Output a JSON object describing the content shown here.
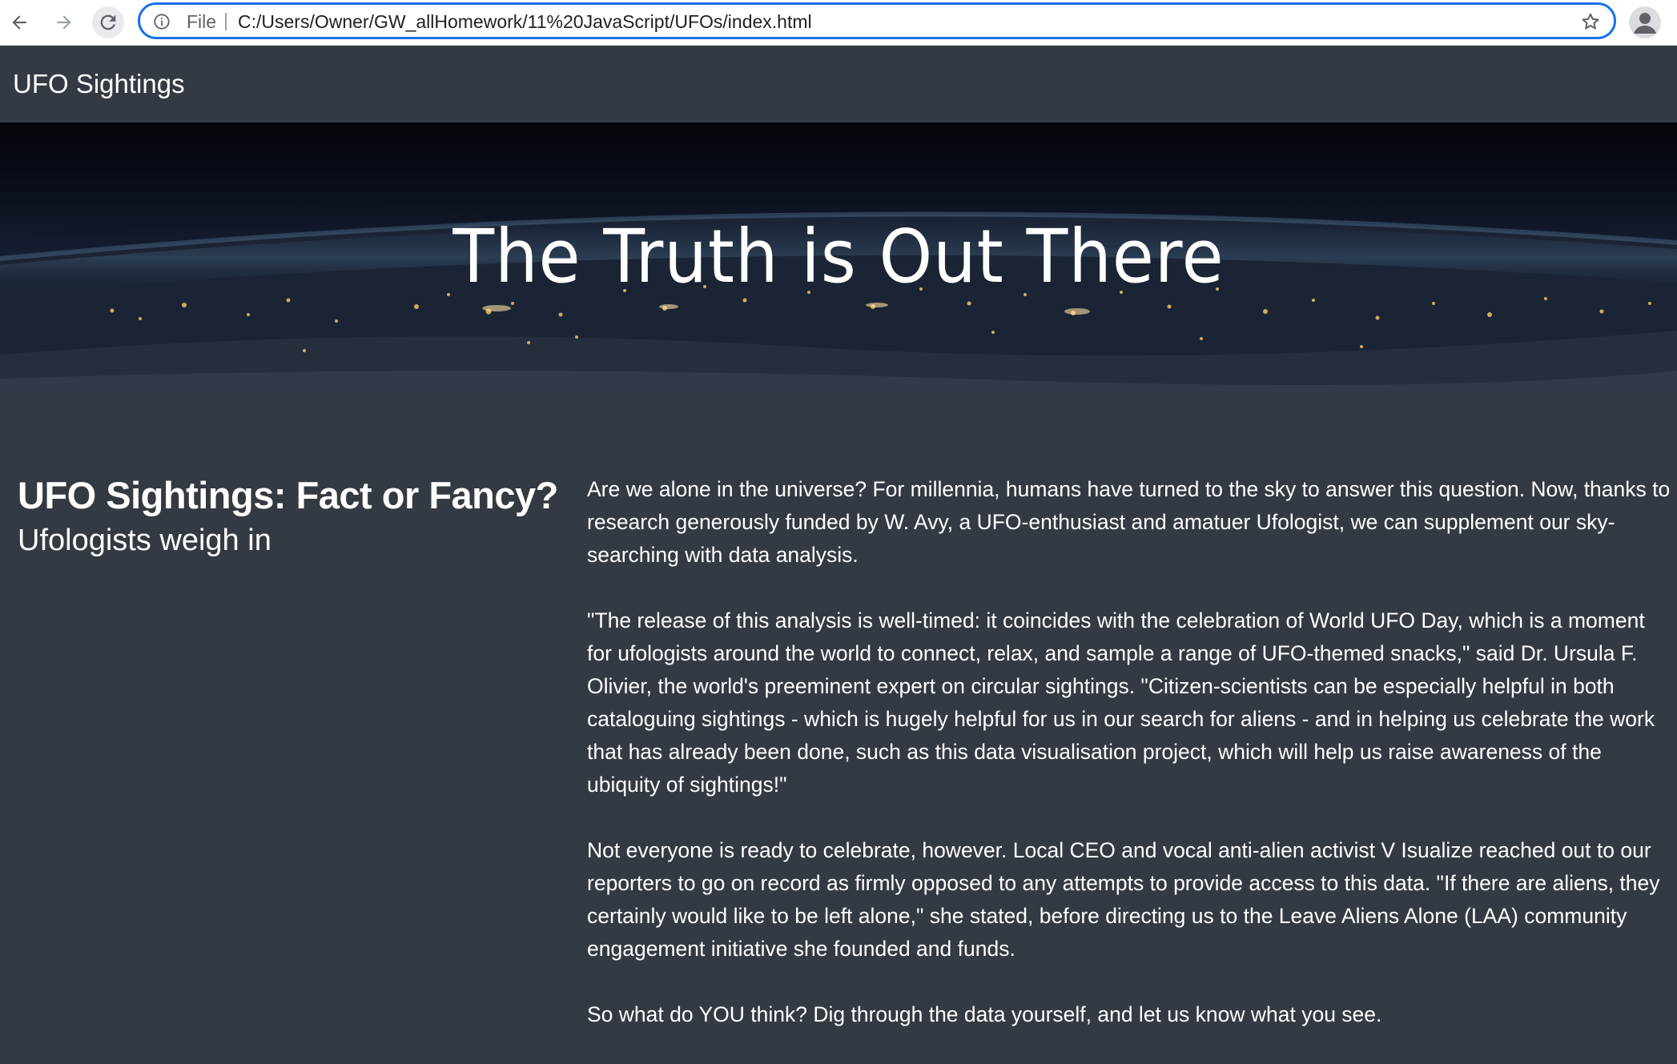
{
  "browser": {
    "file_label": "File",
    "url": "C:/Users/Owner/GW_allHomework/11%20JavaScript/UFOs/index.html",
    "icons": [
      "back-arrow-icon",
      "forward-arrow-icon",
      "reload-icon",
      "info-icon",
      "star-icon",
      "profile-icon"
    ]
  },
  "navbar": {
    "brand": "UFO Sightings"
  },
  "hero": {
    "title": "The Truth is Out There"
  },
  "main": {
    "heading": "UFO Sightings: Fact or Fancy?",
    "subheading": "Ufologists weigh in",
    "paragraphs": [
      "Are we alone in the universe? For millennia, humans have turned to the sky to answer this question. Now, thanks to research generously funded by W. Avy, a UFO-enthusiast and amatuer Ufologist, we can supplement our sky-searching with data analysis.",
      "\"The release of this analysis is well-timed: it coincides with the celebration of World UFO Day, which is a moment for ufologists around the world to connect, relax, and sample a range of UFO-themed snacks,\" said Dr. Ursula F. Olivier, the world's preeminent expert on circular sightings. \"Citizen-scientists can be especially helpful in both cataloguing sightings - which is hugely helpful for us in our search for aliens - and in helping us celebrate the work that has already been done, such as this data visualisation project, which will help us raise awareness of the ubiquity of sightings!\"",
      "Not everyone is ready to celebrate, however. Local CEO and vocal anti-alien activist V Isualize reached out to our reporters to go on record as firmly opposed to any attempts to provide access to this data. \"If there are aliens, they certainly would like to be left alone,\" she stated, before directing us to the Leave Aliens Alone (LAA) community engagement initiative she founded and funds.",
      "So what do YOU think? Dig through the data yourself, and let us know what you see."
    ]
  },
  "colors": {
    "page_bg": "#343a42",
    "omnibox_focus": "#1a73e8",
    "text": "#ffffff"
  }
}
